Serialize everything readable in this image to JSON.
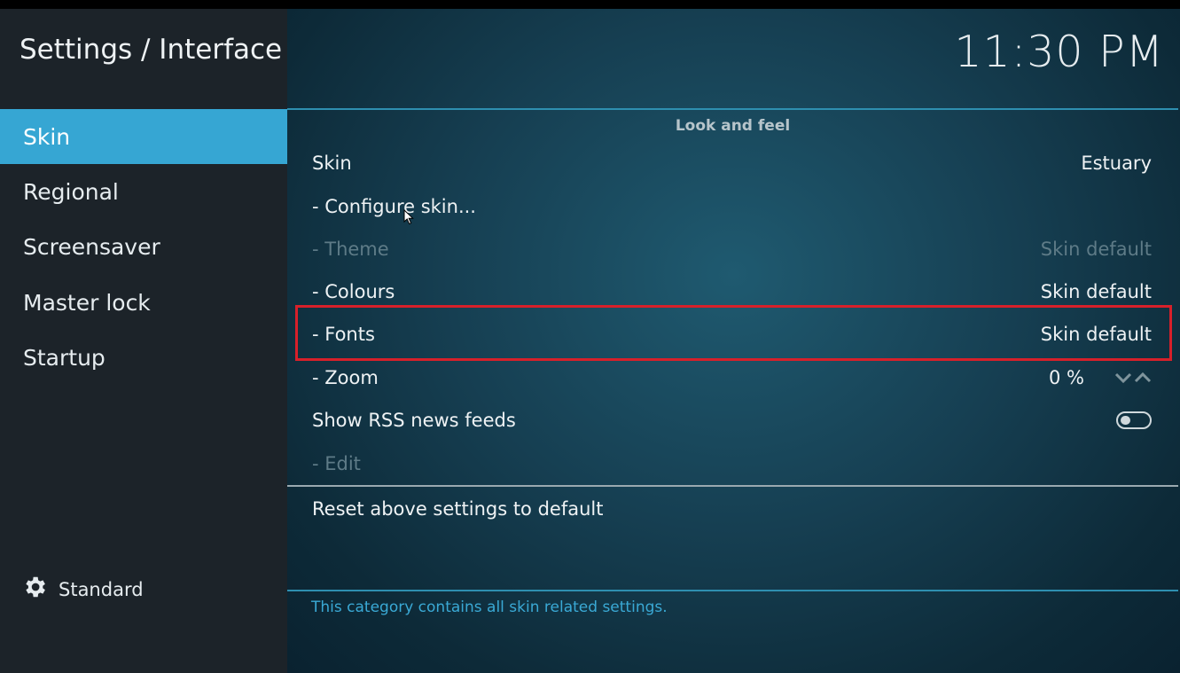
{
  "header": {
    "title": "Settings / Interface",
    "clock": "11:30 PM"
  },
  "sidebar": {
    "items": [
      {
        "label": "Skin",
        "active": true
      },
      {
        "label": "Regional",
        "active": false
      },
      {
        "label": "Screensaver",
        "active": false
      },
      {
        "label": "Master lock",
        "active": false
      },
      {
        "label": "Startup",
        "active": false
      }
    ],
    "level_label": "Standard",
    "level_icon": "gear-icon"
  },
  "main": {
    "group_title": "Look and feel",
    "settings": [
      {
        "label": "Skin",
        "value": "Estuary",
        "enabled": true
      },
      {
        "label": "- Configure skin...",
        "value": "",
        "enabled": true
      },
      {
        "label": "- Theme",
        "value": "Skin default",
        "enabled": false
      },
      {
        "label": "- Colours",
        "value": "Skin default",
        "enabled": true
      },
      {
        "label": "- Fonts",
        "value": "Skin default",
        "enabled": true,
        "highlighted": true
      },
      {
        "label": "- Zoom",
        "value": "0 %",
        "enabled": true
      },
      {
        "label": "Show RSS news feeds",
        "value": "",
        "enabled": true,
        "toggle": false
      },
      {
        "label": "- Edit",
        "value": "",
        "enabled": false
      }
    ],
    "reset_label": "Reset above settings to default",
    "description": "This category contains all skin related settings."
  },
  "colors": {
    "accent": "#36a6d3",
    "highlight_border": "#d7202a"
  }
}
